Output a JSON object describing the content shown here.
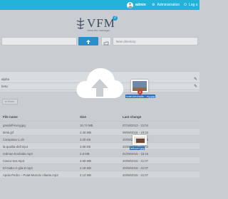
{
  "topbar": {
    "user": "admin",
    "admin_label": "Administration",
    "logout_label": "Log o"
  },
  "logo": {
    "title": "VFM",
    "subtitle": "Veno file manager",
    "badge": "2"
  },
  "toolbar": {
    "newdir_placeholder": "New directory"
  },
  "folders": [
    {
      "name": "alpha"
    },
    {
      "name": "beta"
    }
  ],
  "move_label": "Move",
  "table": {
    "headers": {
      "name": "File name",
      "size": "Size",
      "changed": "Last change"
    },
    "rows": [
      {
        "name": "gandalf-kung.jpg",
        "size": "16.74 MB",
        "date": "07/16/2013 - 21:04"
      },
      {
        "name": "bimk.gif",
        "size": "2.45 MB",
        "date": "09/08/2015 - 19:34"
      },
      {
        "name": "Campania-1.xls",
        "size": "3.00 KB",
        "date": "20/08/2015 - 12:03"
      },
      {
        "name": "la-qualita-dell.mp4",
        "size": "3.96 KB",
        "date": "20/08/2015 - 12:03"
      },
      {
        "name": "redman-bonfalds.mp3",
        "size": "2.8 MB",
        "date": "01/09/2015 - 16:15"
      },
      {
        "name": "Casco-test.mp3",
        "size": "3.68 MB",
        "date": "20/08/2015 - 21:07"
      },
      {
        "name": "El-Gatto-A-gila-Z.mp3",
        "size": "2.19 MB",
        "date": "20/08/2015 - 21:07"
      },
      {
        "name": "Apolo Pedro – Putat-Monolo Allante.mp3",
        "size": "2.13 MB",
        "date": "20/08/2015 - 21:07"
      }
    ]
  },
  "drag": {
    "file1": "hotel-birchalls....eg.jpg",
    "file2": "leftover.jpg",
    "count": "2"
  },
  "colors": {
    "topbar": "#23b3d8",
    "primary": "#2a8ec8",
    "badge": "#d9342b"
  }
}
